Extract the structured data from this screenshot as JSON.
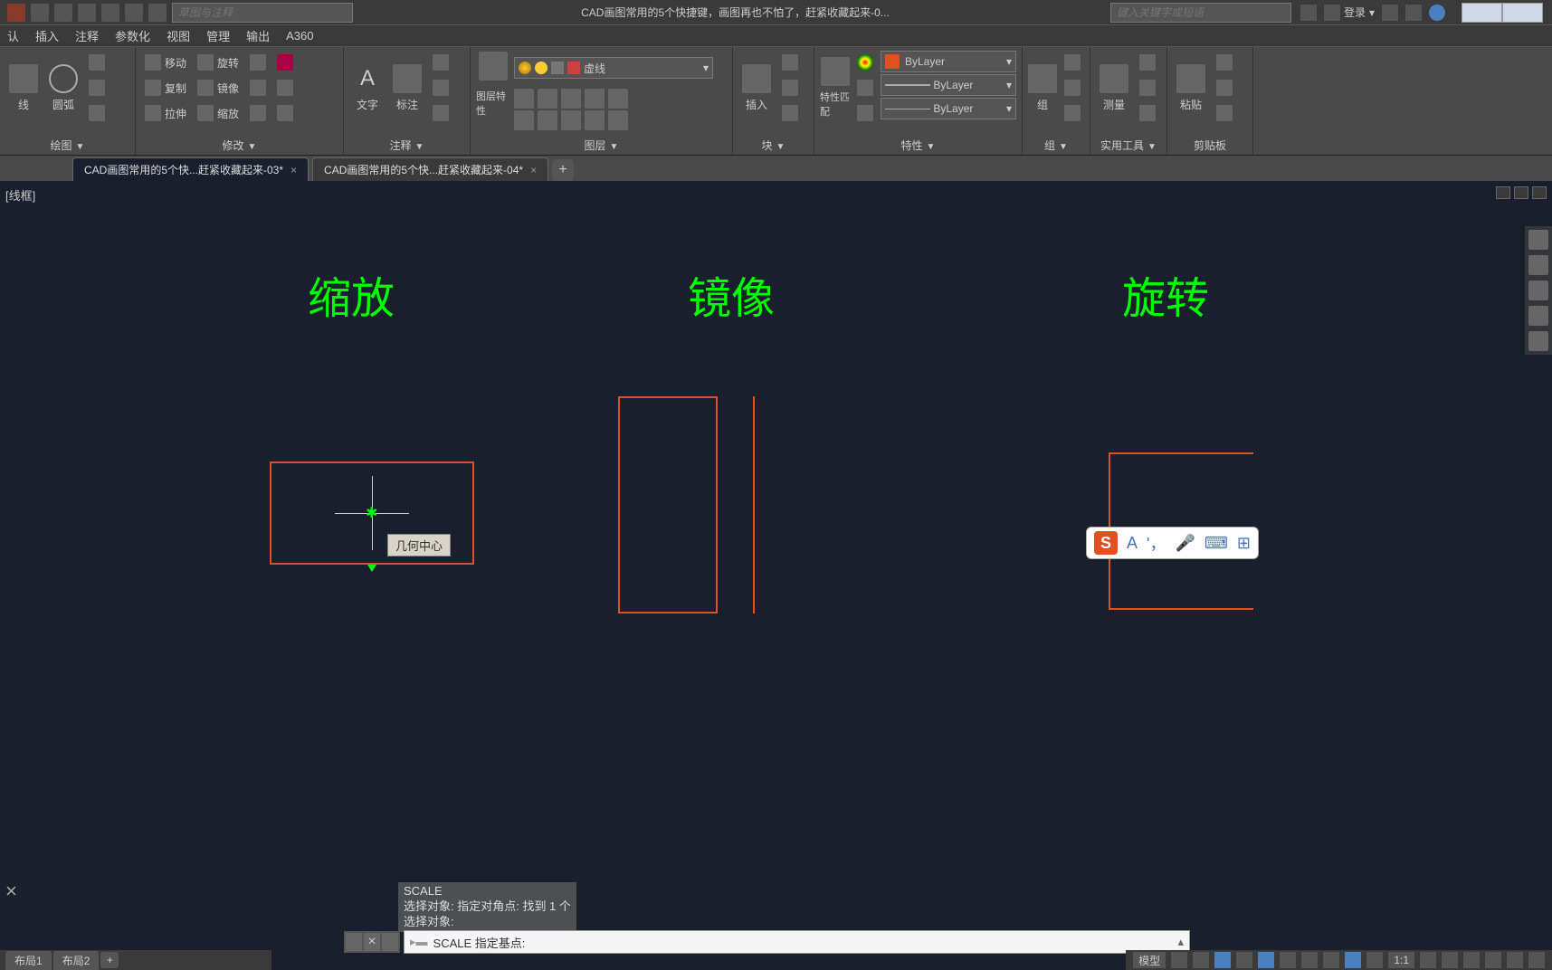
{
  "title_bar": {
    "search_placeholder": "草图与注释",
    "title": "CAD画图常用的5个快捷键，画图再也不怕了，赶紧收藏起来-0...",
    "keyword_placeholder": "键入关键字或短语",
    "login": "登录"
  },
  "menu": {
    "items": [
      "认",
      "插入",
      "注释",
      "参数化",
      "视图",
      "管理",
      "输出",
      "A360"
    ]
  },
  "ribbon": {
    "panels": {
      "draw": {
        "title": "绘图",
        "line": "线",
        "arc": "圆弧"
      },
      "modify": {
        "title": "修改",
        "move": "移动",
        "rotate": "旋转",
        "copy": "复制",
        "mirror": "镜像",
        "stretch": "拉伸",
        "scale": "缩放"
      },
      "annotate": {
        "title": "注释",
        "text": "文字",
        "dim": "标注"
      },
      "layers": {
        "title": "图层",
        "props": "图层特性",
        "current": "虚线"
      },
      "block": {
        "title": "块",
        "insert": "插入"
      },
      "properties": {
        "title": "特性",
        "match": "特性匹配",
        "bylayer": "ByLayer"
      },
      "group": {
        "title": "组",
        "group_btn": "组"
      },
      "utilities": {
        "title": "实用工具",
        "measure": "测量"
      },
      "clipboard": {
        "title": "剪贴板",
        "paste": "粘贴"
      }
    }
  },
  "doc_tabs": {
    "tab1": "CAD画图常用的5个快...赶紧收藏起来-03*",
    "tab2": "CAD画图常用的5个快...赶紧收藏起来-04*"
  },
  "view_label": "[线框]",
  "labels": {
    "scale": "缩放",
    "mirror": "镜像",
    "rotate": "旋转"
  },
  "tooltip": "几何中心",
  "command_history": {
    "cmd": "SCALE",
    "l1": "选择对象: 指定对角点: 找到 1 个",
    "l2": "选择对象:"
  },
  "command_line": "SCALE 指定基点:",
  "layout_tabs": {
    "t1": "布局1",
    "t2": "布局2"
  },
  "status_bar": {
    "model": "模型",
    "scale": "1:1"
  },
  "ime": {
    "letter": "S",
    "mode": "A"
  }
}
